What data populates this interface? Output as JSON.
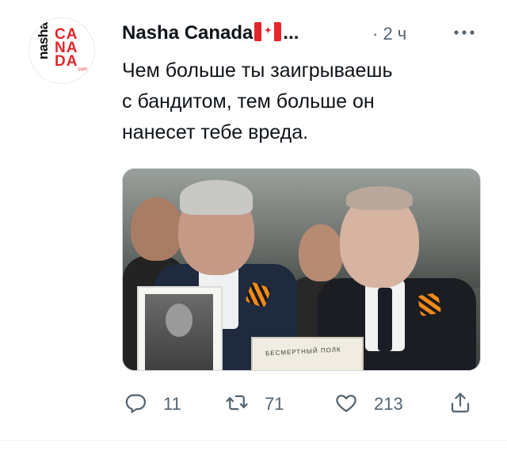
{
  "tweet": {
    "avatar": {
      "logo_top": "nasha",
      "logo_lines": [
        "CA",
        "NA",
        "DA"
      ],
      "logo_suffix": ".com"
    },
    "author_name": "Nasha Canada",
    "author_flag_icon": "canada-flag-icon",
    "name_ellipsis": "...",
    "timestamp": "· 2 ч",
    "more_icon": "more-horizontal-icon",
    "text_lines": [
      "Чем больше ты заигрываешь",
      "с бандитом, тем больше он",
      "нанесет тебе вреда."
    ],
    "media": {
      "placard_text": "БЕСМЕРТНЫЙ ПОЛК"
    },
    "actions": {
      "reply": {
        "icon": "reply-icon",
        "count": "11"
      },
      "retweet": {
        "icon": "retweet-icon",
        "count": "71"
      },
      "like": {
        "icon": "heart-icon",
        "count": "213"
      },
      "share": {
        "icon": "share-icon"
      }
    }
  },
  "colors": {
    "text": "#0f1419",
    "secondary": "#536471",
    "brand_red": "#e3262b",
    "border": "#cfd9de"
  }
}
